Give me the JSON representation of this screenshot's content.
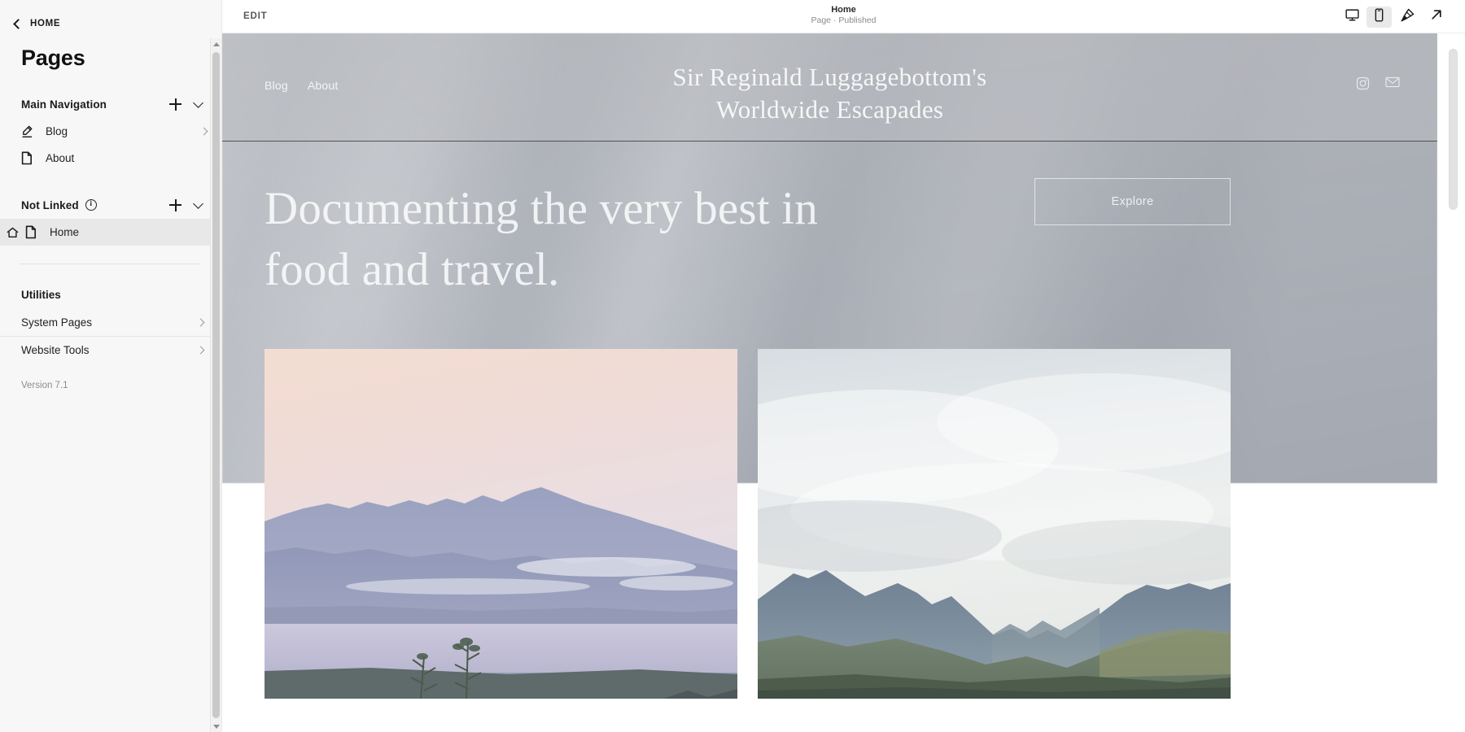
{
  "sidebar": {
    "back_label": "HOME",
    "title": "Pages",
    "sections": [
      {
        "id": "main-navigation",
        "label": "Main Navigation",
        "has_info": false,
        "items": [
          {
            "label": "Blog",
            "icon": "pen-icon",
            "has_chevron": true,
            "is_home": false
          },
          {
            "label": "About",
            "icon": "page-icon",
            "has_chevron": false,
            "is_home": false
          }
        ]
      },
      {
        "id": "not-linked",
        "label": "Not Linked",
        "has_info": true,
        "info_glyph": "i",
        "items": [
          {
            "label": "Home",
            "icon": "page-icon",
            "has_chevron": false,
            "is_home": true
          }
        ]
      }
    ],
    "utilities_label": "Utilities",
    "utilities": [
      {
        "label": "System Pages"
      },
      {
        "label": "Website Tools"
      }
    ],
    "version": "Version 7.1"
  },
  "topbar": {
    "edit_label": "EDIT",
    "page_title": "Home",
    "page_status": "Page · Published",
    "devices": [
      {
        "name": "desktop-view",
        "icon": "monitor-icon",
        "active": false
      },
      {
        "name": "mobile-view",
        "icon": "phone-icon",
        "active": true
      }
    ],
    "actions": [
      {
        "name": "style-editor",
        "icon": "paintbrush-icon"
      },
      {
        "name": "open-in-new-window",
        "icon": "arrow-up-right-icon"
      }
    ]
  },
  "site": {
    "nav": [
      {
        "label": "Blog"
      },
      {
        "label": "About"
      }
    ],
    "title_line1": "Sir Reginald Luggagebottom's",
    "title_line2": "Worldwide Escapades",
    "social": [
      {
        "name": "instagram-icon"
      },
      {
        "name": "email-icon"
      }
    ],
    "hero_heading_line1": "Documenting the very best in",
    "hero_heading_line2": "food and travel.",
    "cta_label": "Explore",
    "photos": [
      {
        "name": "lake-mountains-dusk-photo",
        "alt": "Pastel dusk over a lake with distant mountain range"
      },
      {
        "name": "cloudy-valley-mountains-photo",
        "alt": "Green mountain valley under heavy grey clouds"
      }
    ]
  },
  "colors": {
    "sidebar_bg": "#f7f7f7",
    "sidebar_selected": "#e8e8e8",
    "text_primary": "#1b1b1b",
    "text_muted": "#8b8b8b",
    "hero_overlay": "#a9adb5",
    "toolbar_active": "#e9e9e9"
  }
}
